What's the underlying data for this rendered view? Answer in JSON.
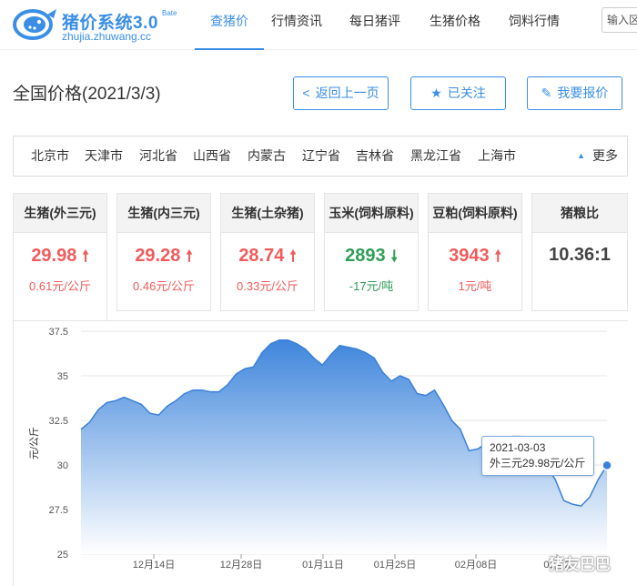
{
  "header": {
    "logo_title": "猪价系统3.0",
    "logo_beta": "Bate",
    "logo_domain": "zhujia.zhuwang.cc",
    "nav": [
      "查猪价",
      "行情资讯",
      "每日猪评",
      "生猪价格",
      "饲料行情"
    ],
    "active_nav": 0,
    "search_placeholder": "输入区"
  },
  "page": {
    "title": "全国价格(2021/3/3)",
    "back_button": "返回上一页",
    "follow_button": "已关注",
    "report_button": "我要报价"
  },
  "provinces": {
    "items": [
      "北京市",
      "天津市",
      "河北省",
      "山西省",
      "内蒙古",
      "辽宁省",
      "吉林省",
      "黑龙江省",
      "上海市"
    ],
    "more_label": "更多"
  },
  "cards": [
    {
      "title": "生猪(外三元)",
      "price": "29.98",
      "trend": "up",
      "change": "0.61元/公斤"
    },
    {
      "title": "生猪(内三元)",
      "price": "29.28",
      "trend": "up",
      "change": "0.46元/公斤"
    },
    {
      "title": "生猪(土杂猪)",
      "price": "28.74",
      "trend": "up",
      "change": "0.33元/公斤"
    },
    {
      "title": "玉米(饲料原料)",
      "price": "2893",
      "trend": "down",
      "change": "-17元/吨"
    },
    {
      "title": "豆粕(饲料原料)",
      "price": "3943",
      "trend": "up",
      "change": "1元/吨"
    },
    {
      "title": "猪粮比",
      "price": "10.36:1",
      "trend": "none",
      "change": ""
    }
  ],
  "colors": {
    "accent": "#3a8ee6",
    "up": "#f15b5b",
    "down": "#2e9e57",
    "area_top": "#4b8fe0",
    "area_bottom": "#ffffff"
  },
  "tooltip": {
    "date": "2021-03-03",
    "text": "外三元29.98元/公斤"
  },
  "watermark": "猪友巴巴",
  "chart_data": {
    "type": "area",
    "ylabel": "元/公斤",
    "xlabel": "",
    "ylim": [
      25,
      37.5
    ],
    "yticks": [
      "37.5",
      "35",
      "32.5",
      "30",
      "27.5",
      "25"
    ],
    "xticks": [
      "12月14日",
      "12月28日",
      "01月11日",
      "01月25日",
      "02月08日",
      "02月2"
    ],
    "grid": true,
    "series": [
      {
        "values": [
          32.0,
          32.4,
          33.1,
          33.5,
          33.6,
          33.8,
          33.6,
          33.4,
          32.9,
          32.8,
          33.3,
          33.6,
          34.0,
          34.2,
          34.2,
          34.1,
          34.1,
          34.5,
          35.1,
          35.4,
          35.5,
          36.3,
          36.8,
          37.0,
          37.0,
          36.8,
          36.5,
          36.0,
          35.6,
          36.2,
          36.7,
          36.6,
          36.5,
          36.3,
          36.0,
          35.2,
          34.7,
          35.0,
          34.8,
          34.0,
          33.9,
          34.2,
          33.4,
          32.5,
          32.0,
          30.8,
          30.9,
          31.2,
          31.4,
          31.5,
          31.6,
          31.6,
          31.3,
          30.7,
          29.9,
          29.2,
          28.0,
          27.8,
          27.7,
          28.2,
          29.2,
          29.98
        ]
      }
    ]
  }
}
